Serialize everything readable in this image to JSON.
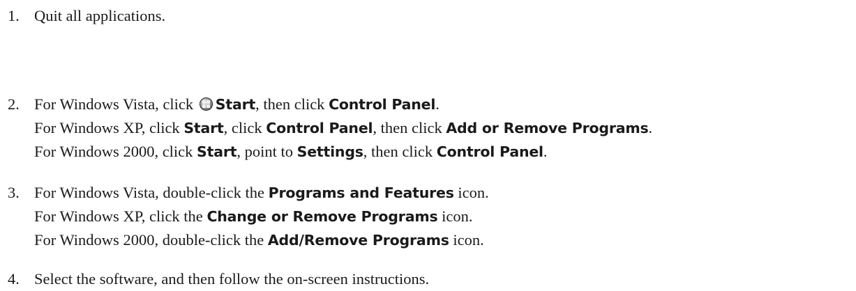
{
  "steps": [
    {
      "number": "1.",
      "lines": [
        [
          "Quit all applications."
        ]
      ]
    },
    {
      "number": "2.",
      "lines": [
        [
          "For Windows Vista, click ",
          "Start",
          ", then click ",
          "Control Panel",
          "."
        ],
        [
          "For Windows XP, click ",
          "Start",
          ", click ",
          "Control Panel",
          ", then click ",
          "Add or Remove Programs",
          "."
        ],
        [
          "For Windows 2000, click ",
          "Start",
          ", point to ",
          "Settings",
          ", then click ",
          "Control Panel",
          "."
        ]
      ]
    },
    {
      "number": "3.",
      "lines": [
        [
          "For Windows Vista, double-click the ",
          "Programs and Features",
          " icon."
        ],
        [
          "For Windows XP, click the ",
          "Change or Remove Programs",
          " icon."
        ],
        [
          "For Windows 2000, double-click the ",
          "Add/Remove Programs",
          " icon."
        ]
      ]
    },
    {
      "number": "4.",
      "lines": [
        [
          "Select the software, and then follow the on-screen instructions."
        ]
      ]
    }
  ],
  "icons": {
    "vista_start": "windows-start-orb-icon"
  }
}
